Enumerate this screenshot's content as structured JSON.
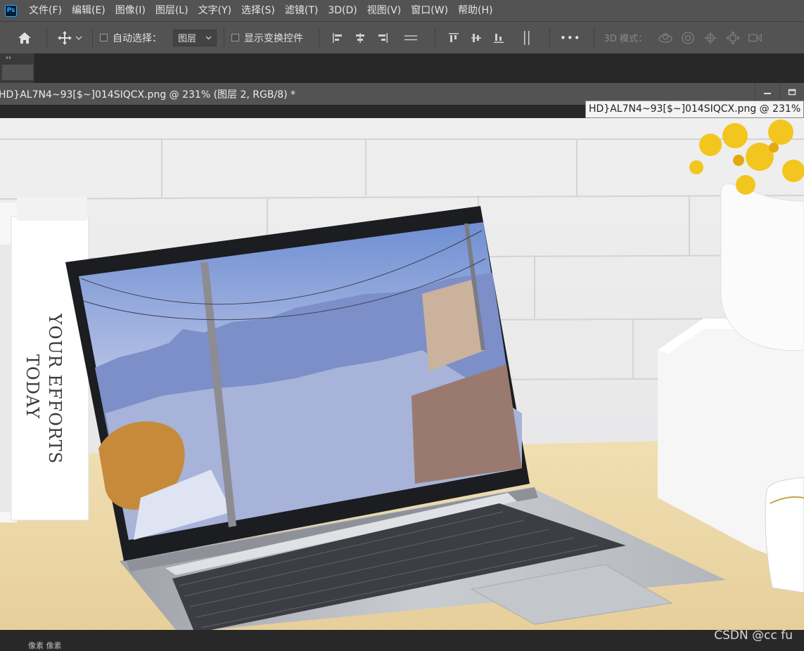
{
  "app": {
    "logo_text": "Ps"
  },
  "menu": [
    "文件(F)",
    "编辑(E)",
    "图像(I)",
    "图层(L)",
    "文字(Y)",
    "选择(S)",
    "滤镜(T)",
    "3D(D)",
    "视图(V)",
    "窗口(W)",
    "帮助(H)"
  ],
  "options": {
    "auto_select_label": "自动选择：",
    "auto_select_target": "图层",
    "show_transform_label": "显示变换控件",
    "more_label": "•••",
    "mode_3d_label": "3D 模式："
  },
  "panel": {
    "collapse_label": "››"
  },
  "document": {
    "tab_title": "HD}AL7N4~93[$~]014SIQCX.png @ 231% (图层 2, RGB/8) *",
    "tooltip": "HD}AL7N4~93[$~]014SIQCX.png @ 231%"
  },
  "image": {
    "book_text_line1": "YOUR EFFORTS",
    "book_text_line2": "TODAY"
  },
  "status": {
    "text": "像素      像素"
  },
  "watermark": "CSDN @cc fu",
  "colors": {
    "menu_bg": "#535353",
    "workspace_bg": "#282828",
    "accent": "#31a8ff"
  }
}
